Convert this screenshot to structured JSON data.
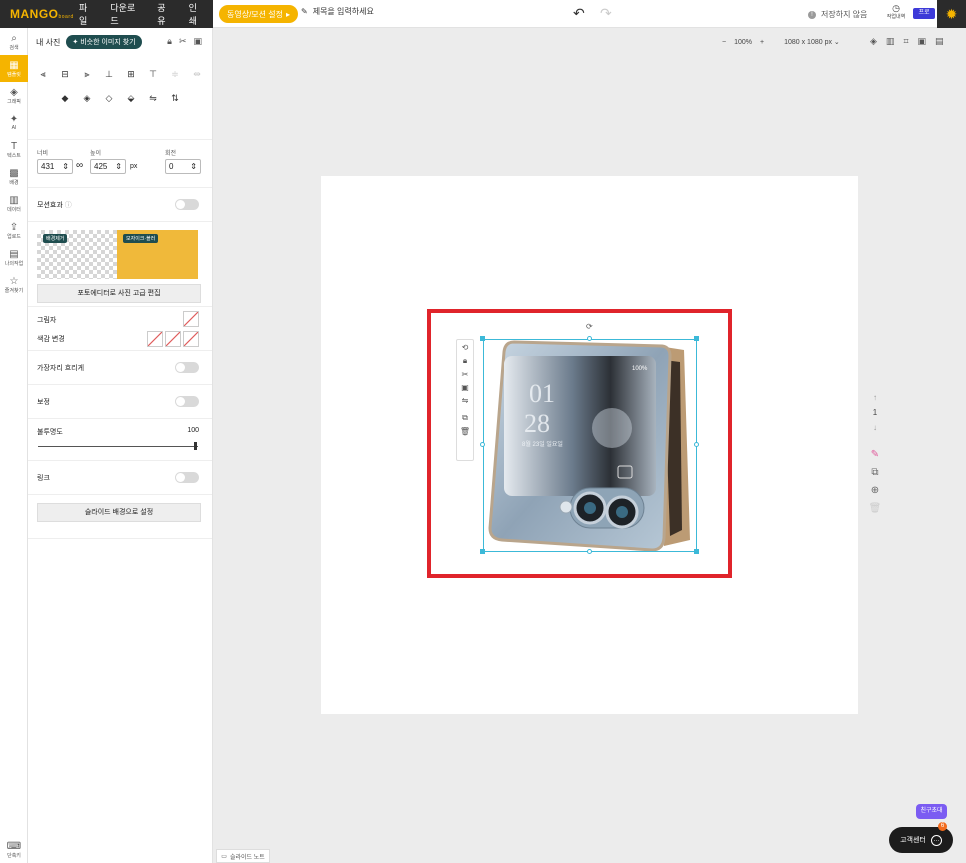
{
  "topbar": {
    "logo": "MANGO",
    "logo_sub": "board",
    "menu": [
      "파일",
      "다운로드",
      "공유",
      "인쇄"
    ],
    "video_setting": "동영상/모션 설정",
    "title_placeholder": "제목을 입력하세요",
    "save_status": "저장하지 않음",
    "save_status_icon": "!",
    "history_label": "작업내역",
    "plan_badge": "프로"
  },
  "leftnav": {
    "items": [
      {
        "label": "검색",
        "icon": "search-icon",
        "glyph": "⌕"
      },
      {
        "label": "템플릿",
        "icon": "template-icon",
        "glyph": "▦"
      },
      {
        "label": "그래픽",
        "icon": "graphic-icon",
        "glyph": "◈"
      },
      {
        "label": "AI",
        "icon": "ai-icon",
        "glyph": "✦"
      },
      {
        "label": "텍스트",
        "icon": "text-icon",
        "glyph": "T"
      },
      {
        "label": "배경",
        "icon": "background-icon",
        "glyph": "▩"
      },
      {
        "label": "데이터",
        "icon": "data-icon",
        "glyph": "▥"
      },
      {
        "label": "업로드",
        "icon": "upload-icon",
        "glyph": "⇪"
      },
      {
        "label": "나의작업",
        "icon": "folder-icon",
        "glyph": "▤"
      },
      {
        "label": "즐겨찾기",
        "icon": "star-icon",
        "glyph": "☆"
      }
    ],
    "bottom_label": "단축키",
    "active_index": 1
  },
  "panel": {
    "my_photos": "내 사진",
    "find_similar": "비슷한 이미지 찾기",
    "dims": {
      "width_label": "너비",
      "width_value": "431",
      "height_label": "높이",
      "height_value": "425",
      "unit": "px",
      "rotation_label": "회전",
      "rotation_value": "0"
    },
    "motion_label": "모션효과",
    "promo": {
      "tag_left": "배경제거",
      "tag_right": "모자이크·블러",
      "button": "포토에디터로 사진 고급 편집"
    },
    "shadow_label": "그림자",
    "color_change_label": "색감 변경",
    "blur_edge_label": "가장자리 흐리게",
    "correction_label": "보정",
    "opacity_label": "불투명도",
    "opacity_value": "100",
    "link_label": "링크",
    "set_bg_button": "슬라이드 배경으로 설정"
  },
  "canvas_toolbar": {
    "zoom_minus": "−",
    "zoom": "100%",
    "zoom_plus": "+",
    "size": "1080 x 1080 px"
  },
  "page_nav": {
    "page": "1"
  },
  "phone_screen": {
    "status": "100%",
    "hour": "01",
    "minute": "28",
    "date": "8월 23일 일요일"
  },
  "bottom": {
    "slide_note": "슬라이드 노트",
    "invite": "친구초대",
    "support": "고객센터",
    "support_badge": "6"
  }
}
